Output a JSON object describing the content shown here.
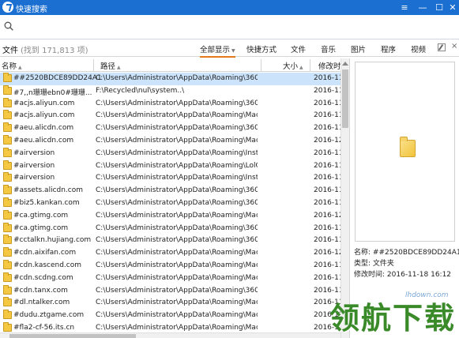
{
  "app": {
    "title": "快速搜索",
    "window_controls": {
      "menu": "≡",
      "minimize": "—",
      "maximize": "☐",
      "close": "✕"
    }
  },
  "search": {
    "value": "",
    "placeholder": ""
  },
  "filter_bar": {
    "label": "文件",
    "count": "(找到 171,813 项)",
    "tabs": [
      {
        "label": "全部显示",
        "active": true,
        "has_arrow": true
      },
      {
        "label": "快捷方式"
      },
      {
        "label": "文件"
      },
      {
        "label": "音乐"
      },
      {
        "label": "图片"
      },
      {
        "label": "程序"
      },
      {
        "label": "视频"
      }
    ],
    "close": "×"
  },
  "columns": {
    "name": "名称",
    "path": "路径",
    "size": "大小",
    "modified": "修改时"
  },
  "files": [
    {
      "name": "##2520BDCE89DD24A1",
      "path": "C:\\Users\\Administrator\\AppData\\Roaming\\360se6\\",
      "date": "2016-11",
      "selected": true
    },
    {
      "name": "#7,,n珊珊ebn0#珊珊...",
      "path": "F:\\Recycled\\nul\\system..\\",
      "date": "2016-11"
    },
    {
      "name": "#acjs.aliyun.com",
      "path": "C:\\Users\\Administrator\\AppData\\Roaming\\360se6\\",
      "date": "2016-11"
    },
    {
      "name": "#acjs.aliyun.com",
      "path": "C:\\Users\\Administrator\\AppData\\Roaming\\Macrome",
      "date": "2016-11"
    },
    {
      "name": "#aeu.alicdn.com",
      "path": "C:\\Users\\Administrator\\AppData\\Roaming\\360se6\\",
      "date": "2016-11"
    },
    {
      "name": "#aeu.alicdn.com",
      "path": "C:\\Users\\Administrator\\AppData\\Roaming\\Macrome",
      "date": "2016-12"
    },
    {
      "name": "#airversion",
      "path": "C:\\Users\\Administrator\\AppData\\Roaming\\Insta360",
      "date": "2016-11"
    },
    {
      "name": "#airversion",
      "path": "C:\\Users\\Administrator\\AppData\\Roaming\\LolClient\\",
      "date": "2016-11"
    },
    {
      "name": "#airversion",
      "path": "C:\\Users\\Administrator\\AppData\\Roaming\\Insta360",
      "date": "2016-11"
    },
    {
      "name": "#assets.alicdn.com",
      "path": "C:\\Users\\Administrator\\AppData\\Roaming\\360se6\\",
      "date": "2016-11"
    },
    {
      "name": "#biz5.kankan.com",
      "path": "C:\\Users\\Administrator\\AppData\\Roaming\\360se6\\",
      "date": "2016-11"
    },
    {
      "name": "#ca.gtimg.com",
      "path": "C:\\Users\\Administrator\\AppData\\Roaming\\Macrome",
      "date": "2016-12"
    },
    {
      "name": "#ca.gtimg.com",
      "path": "C:\\Users\\Administrator\\AppData\\Roaming\\360se6\\",
      "date": "2016-11"
    },
    {
      "name": "#cctalkn.hujiang.com",
      "path": "C:\\Users\\Administrator\\AppData\\Roaming\\360se6\\",
      "date": "2016-11"
    },
    {
      "name": "#cdn.aixifan.com",
      "path": "C:\\Users\\Administrator\\AppData\\Roaming\\Macrome",
      "date": "2016-12"
    },
    {
      "name": "#cdn.kascend.com",
      "path": "C:\\Users\\Administrator\\AppData\\Roaming\\Macrome",
      "date": "2016-11"
    },
    {
      "name": "#cdn.scdng.com",
      "path": "C:\\Users\\Administrator\\AppData\\Roaming\\Macrome",
      "date": "2016-11"
    },
    {
      "name": "#cdn.tanx.com",
      "path": "C:\\Users\\Administrator\\AppData\\Roaming\\360se6\\",
      "date": "2016-11"
    },
    {
      "name": "#dl.ntalker.com",
      "path": "C:\\Users\\Administrator\\AppData\\Roaming\\Macrome",
      "date": "2016-11"
    },
    {
      "name": "#dudu.ztgame.com",
      "path": "C:\\Users\\Administrator\\AppData\\Roaming\\Macrome",
      "date": "2016-12"
    },
    {
      "name": "#fla2-cf-56.its.cn",
      "path": "C:\\Users\\Administrator\\AppData\\Roaming\\Macrome",
      "date": "2016-11"
    }
  ],
  "preview": {
    "name_label": "名称:",
    "name_value": "##2520BDCE89DD24A1",
    "type_label": "类型:",
    "type_value": "文件夹",
    "modified_label": "修改时间:",
    "modified_value": "2016-11-18 16:12"
  },
  "watermark": {
    "text": "领航下载",
    "url": "lhdown.com"
  }
}
